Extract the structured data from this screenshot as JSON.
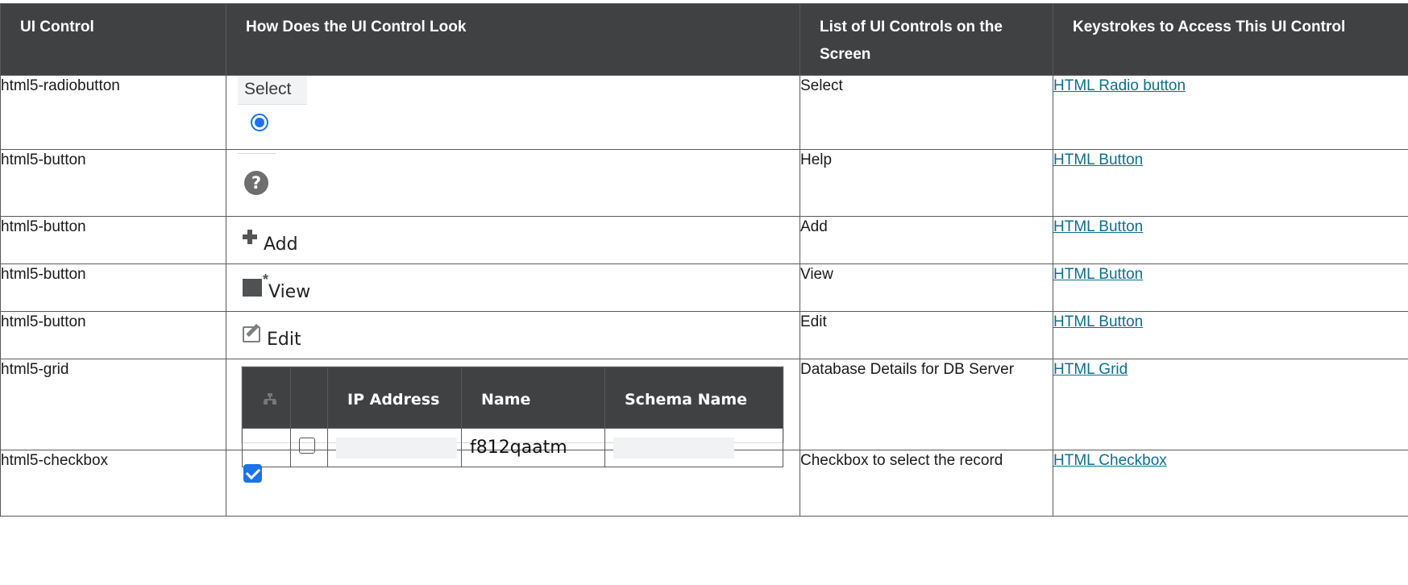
{
  "headers": {
    "ui_control": "UI Control",
    "look": "How Does the UI Control Look",
    "list": "List of UI Controls on the Screen",
    "keystrokes": "Keystrokes to Access This UI Control"
  },
  "rows": [
    {
      "control": "html5-radiobutton",
      "look_label": "Select",
      "list": "Select",
      "link": "HTML Radio button"
    },
    {
      "control": "html5-button",
      "look_label": "",
      "list": "Help",
      "link": "HTML Button"
    },
    {
      "control": "html5-button",
      "look_label": "Add",
      "list": "Add",
      "link": "HTML Button"
    },
    {
      "control": "html5-button",
      "look_label": "View",
      "list": "View",
      "link": "HTML Button"
    },
    {
      "control": "html5-button",
      "look_label": "Edit",
      "list": "Edit",
      "link": "HTML Button"
    },
    {
      "control": "html5-grid",
      "look_label": "",
      "list": "Database Details for DB Server",
      "link": "HTML Grid"
    },
    {
      "control": "html5-checkbox",
      "look_label": "",
      "list": "Checkbox to select the record",
      "link": "HTML Checkbox"
    }
  ],
  "grid": {
    "headers": [
      "IP Address",
      "Name",
      "Schema Name"
    ],
    "row": {
      "name": "f812qaatm"
    }
  },
  "icons": {
    "radio": "radio-selected-icon",
    "help": "help-icon",
    "add": "plus-icon",
    "view": "view-icon",
    "edit": "edit-icon",
    "hierarchy": "hierarchy-icon",
    "checkbox_checked": "checkbox-checked-icon"
  },
  "colors": {
    "header_bg": "#3f4142",
    "link": "#0d6e8e",
    "accent": "#1a73e8"
  }
}
